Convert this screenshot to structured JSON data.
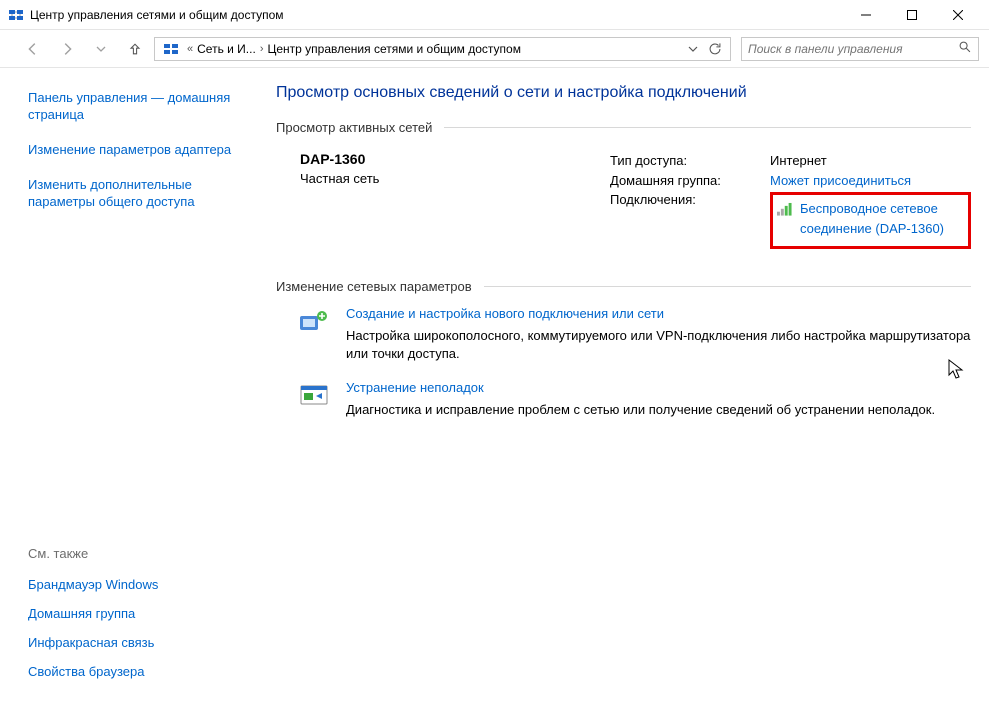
{
  "window": {
    "title": "Центр управления сетями и общим доступом"
  },
  "breadcrumb": {
    "p1": "Сеть и И...",
    "p2": "Центр управления сетями и общим доступом"
  },
  "search": {
    "placeholder": "Поиск в панели управления"
  },
  "sidebar": {
    "link1": "Панель управления — домашняя страница",
    "link2": "Изменение параметров адаптера",
    "link3": "Изменить дополнительные параметры общего доступа",
    "see_also": "См. также",
    "bl1": "Брандмауэр Windows",
    "bl2": "Домашняя группа",
    "bl3": "Инфракрасная связь",
    "bl4": "Свойства браузера"
  },
  "content": {
    "page_title": "Просмотр основных сведений о сети и настройка подключений",
    "section1": "Просмотр активных сетей",
    "network": {
      "name": "DAP-1360",
      "type": "Частная сеть",
      "k1": "Тип доступа:",
      "v1": "Интернет",
      "k2": "Домашняя группа:",
      "v2": "Может присоединиться",
      "k3": "Подключения:",
      "v3": "Беспроводное сетевое соединение (DAP-1360)"
    },
    "section2": "Изменение сетевых параметров",
    "action1": {
      "title": "Создание и настройка нового подключения или сети",
      "desc": "Настройка широкополосного, коммутируемого или VPN-подключения либо настройка маршрутизатора или точки доступа."
    },
    "action2": {
      "title": "Устранение неполадок",
      "desc": "Диагностика и исправление проблем с сетью или получение сведений об устранении неполадок."
    }
  }
}
